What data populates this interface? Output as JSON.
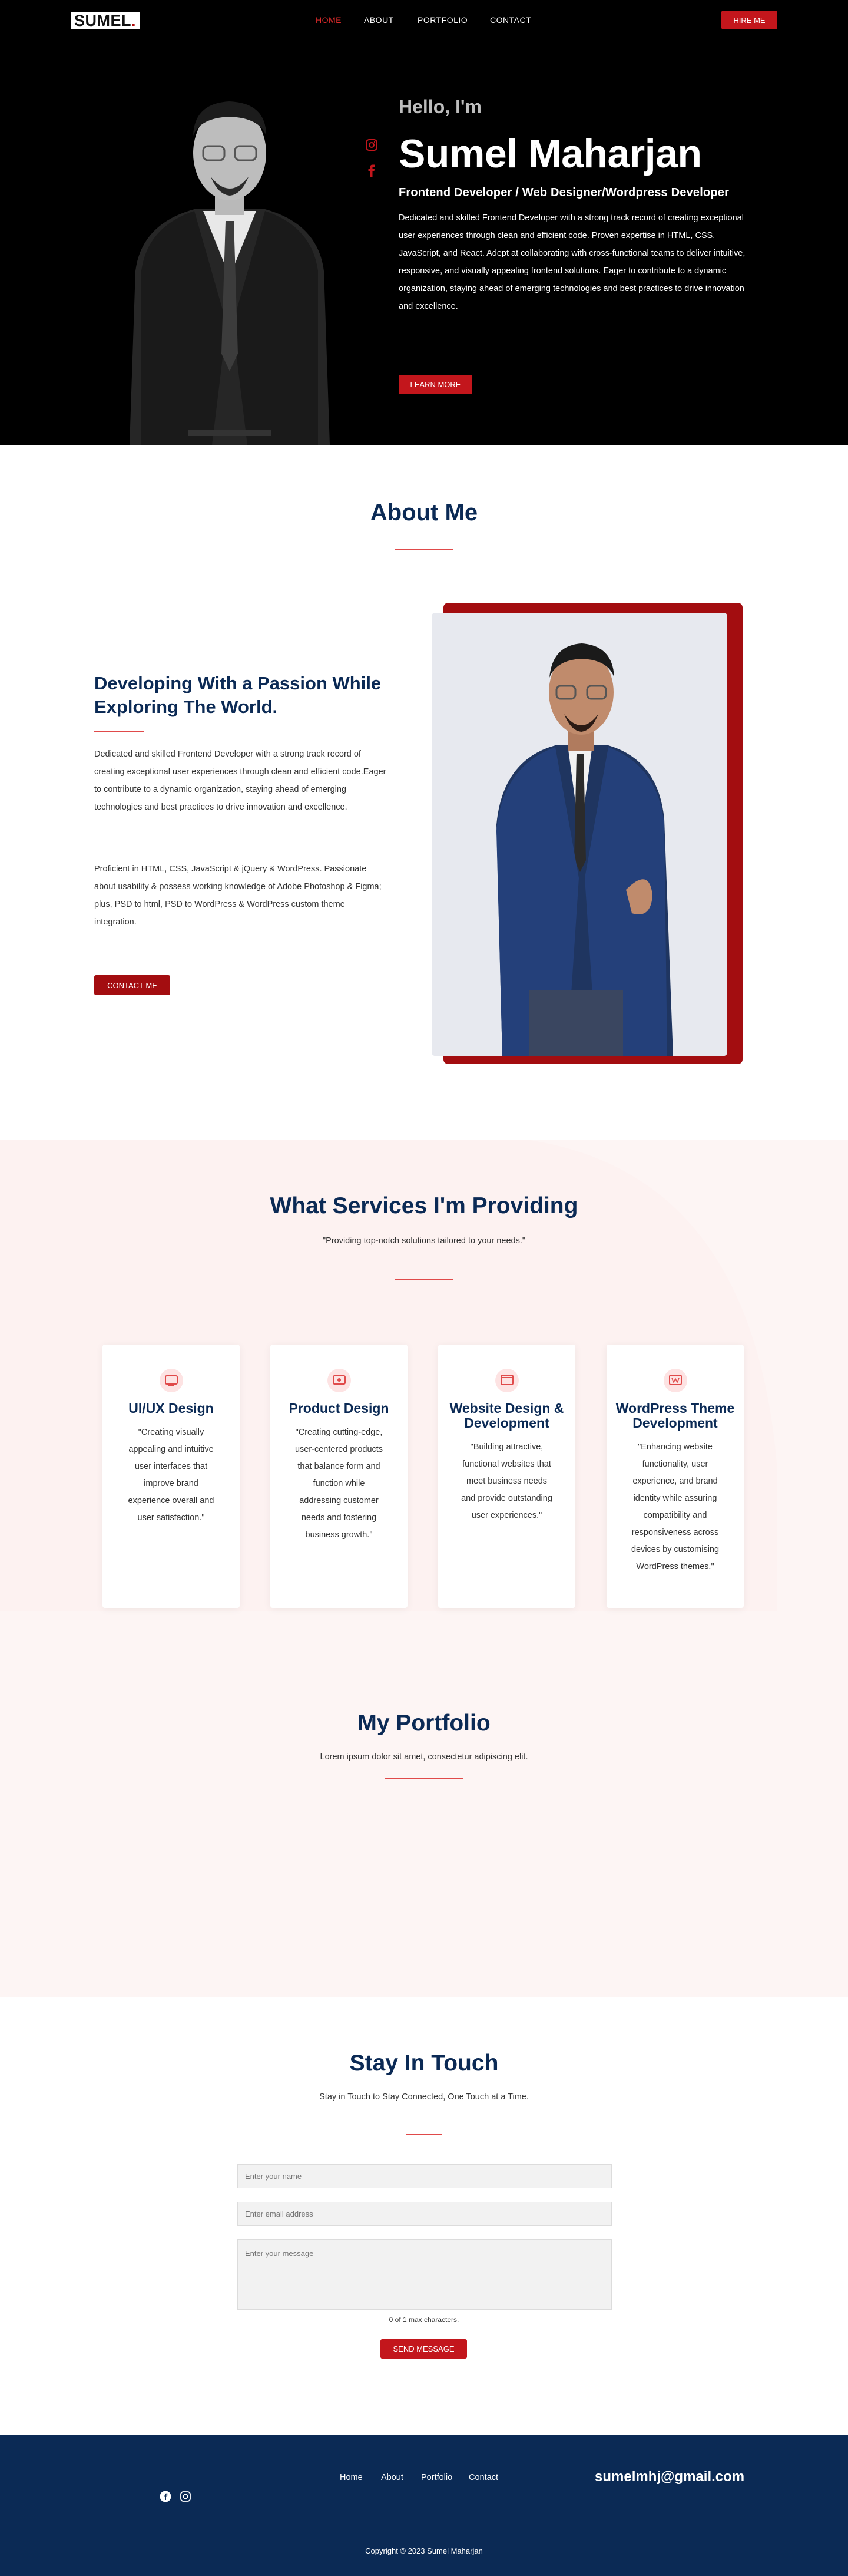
{
  "brand": {
    "logo_text": "SUMEL",
    "logo_dot": "."
  },
  "nav": {
    "items": [
      "HOME",
      "ABOUT",
      "PORTFOLIO",
      "CONTACT"
    ],
    "hire_label": "HIRE ME"
  },
  "hero": {
    "hello": "Hello, I'm",
    "name": "Sumel Maharjan",
    "role": "Frontend Developer / Web Designer/Wordpress Developer",
    "description": "Dedicated and skilled Frontend Developer with a strong track record of creating exceptional user experiences through clean and efficient code. Proven expertise in HTML, CSS, JavaScript, and React. Adept at collaborating with cross-functional teams to deliver intuitive, responsive, and visually appealing frontend solutions. Eager to contribute to a dynamic organization, staying ahead of emerging technologies and best practices to drive innovation and excellence.",
    "learn_more_label": "LEARN MORE",
    "socials": [
      "instagram-icon",
      "facebook-icon"
    ]
  },
  "about": {
    "title": "About Me",
    "heading": "Developing With a Passion While Exploring The World.",
    "paragraph1": "Dedicated and skilled Frontend Developer with a strong track record of creating exceptional user experiences through clean and efficient code.Eager to contribute to a dynamic organization, staying ahead of emerging technologies and best practices to drive innovation and excellence.",
    "paragraph2": "Proficient in HTML, CSS, JavaScript & jQuery & WordPress. Passionate about usability & possess working knowledge of Adobe Photoshop & Figma; plus, PSD to html, PSD to WordPress & WordPress custom theme integration.",
    "contact_label": "CONTACT ME"
  },
  "services": {
    "title": "What Services I'm Providing",
    "subtitle": "\"Providing top-notch solutions tailored to your needs.\"",
    "cards": [
      {
        "icon": "design-icon",
        "title": "UI/UX Design",
        "text": "\"Creating visually appealing and intuitive user interfaces that improve brand experience overall and user satisfaction.\""
      },
      {
        "icon": "product-icon",
        "title": "Product Design",
        "text": "\"Creating cutting-edge, user-centered products that balance form and function while addressing customer needs and fostering business growth.\""
      },
      {
        "icon": "website-icon",
        "title": "Website Design & Development",
        "text": "\"Building attractive, functional websites that meet business needs and provide outstanding user experiences.\""
      },
      {
        "icon": "wordpress-icon",
        "title": "WordPress Theme Development",
        "text": "\"Enhancing website functionality, user experience, and brand identity while assuring compatibility and responsiveness across devices by customising WordPress themes.\""
      }
    ]
  },
  "portfolio": {
    "title": "My Portfolio",
    "subtitle": "Lorem ipsum dolor sit amet, consectetur adipiscing elit."
  },
  "contact": {
    "title": "Stay In Touch",
    "subtitle": "Stay in Touch to Stay Connected, One Touch at a Time.",
    "name_placeholder": "Enter your name",
    "email_placeholder": "Enter email address",
    "message_placeholder": "Enter your message",
    "char_count": "0 of 1 max characters.",
    "send_label": "SEND MESSAGE"
  },
  "footer": {
    "links": [
      "Home",
      "About",
      "Portfolio",
      "Contact"
    ],
    "email": "sumelmhj@gmail.com",
    "socials": [
      "facebook-icon",
      "instagram-icon"
    ],
    "copyright": "Copyright © 2023 Sumel Maharjan"
  },
  "colors": {
    "accent": "#c3161c",
    "dark_red": "#a30d10",
    "navy": "#0b2a55",
    "band_bg": "#fdf5f4"
  }
}
